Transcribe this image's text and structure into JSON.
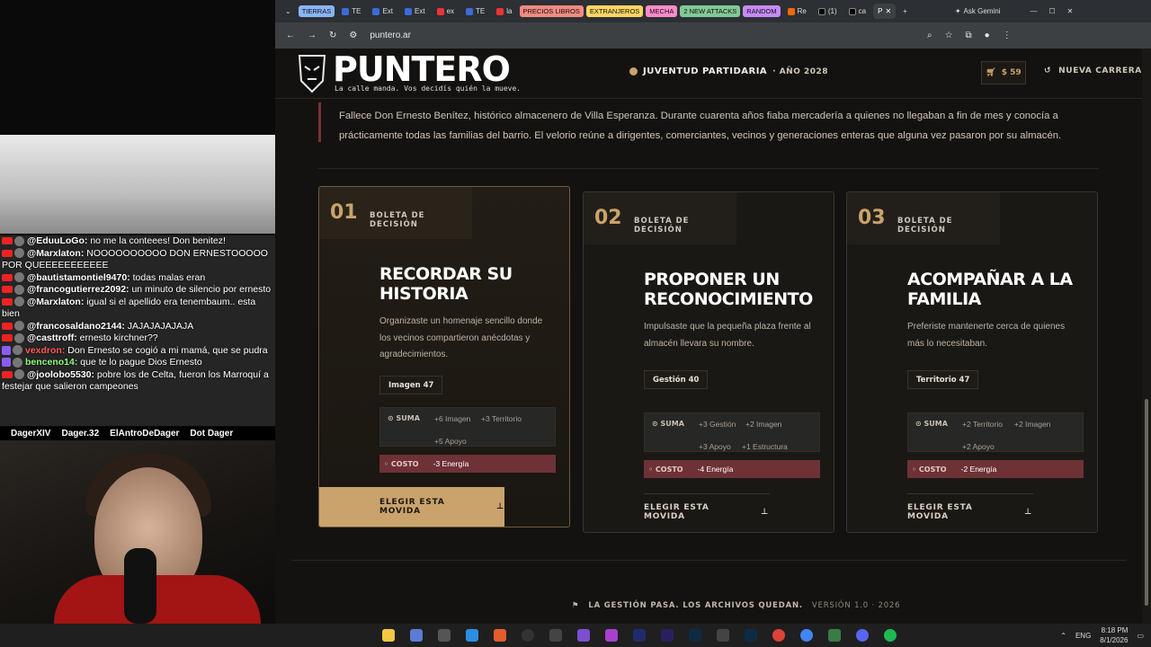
{
  "chat": [
    {
      "user": "@EduuLoGo:",
      "text": "no me la conteees! Don benitez!",
      "src": "yt"
    },
    {
      "user": "@Marxlaton:",
      "text": "NOOOOOOOOOO DON ERNESTOOOOO POR QUEEEEEEEEEEE",
      "src": "yt"
    },
    {
      "user": "@bautistamontiel9470:",
      "text": "todas malas eran",
      "src": "yt"
    },
    {
      "user": "@francogutierrez2092:",
      "text": "un minuto de silencio por ernesto",
      "src": "yt"
    },
    {
      "user": "@Marxlaton:",
      "text": "igual si el apellido era tenembaum.. esta bien",
      "src": "yt"
    },
    {
      "user": "@francosaldano2144:",
      "text": "JAJAJAJAJAJA",
      "src": "yt"
    },
    {
      "user": "@casttroff:",
      "text": "ernesto kirchner??",
      "src": "yt"
    },
    {
      "user": "vexdron:",
      "text": "Don Ernesto se cogió a mi mamá, que se pudra",
      "src": "tw"
    },
    {
      "user": "benceno14:",
      "text": "que te lo pague Dios Ernesto",
      "src": "tw"
    },
    {
      "user": "@joolobo5530:",
      "text": "pobre los de Celta, fueron los Marroquí a festejar que salieron campeones",
      "src": "yt"
    }
  ],
  "socials": [
    "DagerXIV",
    "Dager.32",
    "ElAntroDeDager",
    "Dot Dager"
  ],
  "browser": {
    "tabs": [
      "TIERRAS",
      "TE",
      "Ext",
      "Ext",
      "ex",
      "TE",
      "la",
      "PRECIOS LIBROS",
      "EXTRANJEROS",
      "MECHA",
      "2 NEW ATTACKS",
      "RANDOM",
      "Re",
      "(1)",
      "ca",
      "P"
    ],
    "url": "puntero.ar",
    "gemini": "Ask Gemini"
  },
  "header": {
    "logo": "PUNTERO",
    "tagline": "La calle manda. Vos decidís quién la mueve.",
    "campaign": "JUVENTUD PARTIDARIA",
    "year": "· AÑO 2028",
    "money": "$ 59",
    "new_run": "NUEVA CARRERA"
  },
  "article": "Fallece Don Ernesto Benítez, histórico almacenero de Villa Esperanza. Durante cuarenta años fiaba mercadería a quienes no llegaban a fin de mes y conocía a prácticamente todas las familias del barrio. El velorio reúne a dirigentes, comerciantes, vecinos y generaciones enteras que alguna vez pasaron por su almacén.",
  "cards": [
    {
      "num": "01",
      "label": "BOLETA DE DECISIÓN",
      "title": "RECORDAR SU HISTORIA",
      "desc": "Organizaste un homenaje sencillo donde los vecinos compartieron anécdotas y agradecimientos.",
      "stat": "Imagen 47",
      "suma_label": "SUMA",
      "chips": [
        "+6 Imagen",
        "+3 Territorio",
        "+5 Apoyo"
      ],
      "costo_label": "COSTO",
      "costo": "-3 Energía",
      "cta": "ELEGIR ESTA MOVIDA"
    },
    {
      "num": "02",
      "label": "BOLETA DE DECISIÓN",
      "title": "PROPONER UN RECONOCIMIENTO",
      "desc": "Impulsaste que la pequeña plaza frente al almacén llevara su nombre.",
      "stat": "Gestión 40",
      "suma_label": "SUMA",
      "chips": [
        "+3 Gestión",
        "+2 Imagen",
        "+3 Apoyo",
        "+1 Estructura"
      ],
      "costo_label": "COSTO",
      "costo": "-4 Energía",
      "cta": "ELEGIR ESTA MOVIDA"
    },
    {
      "num": "03",
      "label": "BOLETA DE DECISIÓN",
      "title": "ACOMPAÑAR A LA FAMILIA",
      "desc": "Preferiste mantenerte cerca de quienes más lo necesitaban.",
      "stat": "Territorio 47",
      "suma_label": "SUMA",
      "chips": [
        "+2 Territorio",
        "+2 Imagen",
        "+2 Apoyo"
      ],
      "costo_label": "COSTO",
      "costo": "-2 Energía",
      "cta": "ELEGIR ESTA MOVIDA"
    }
  ],
  "footer": {
    "text": "LA GESTIÓN PASA. LOS ARCHIVOS QUEDAN.",
    "version": "VERSIÓN 1.0 · 2026"
  },
  "taskbar": {
    "lang": "ENG",
    "time": "8:18 PM",
    "date": "8/1/2026"
  }
}
